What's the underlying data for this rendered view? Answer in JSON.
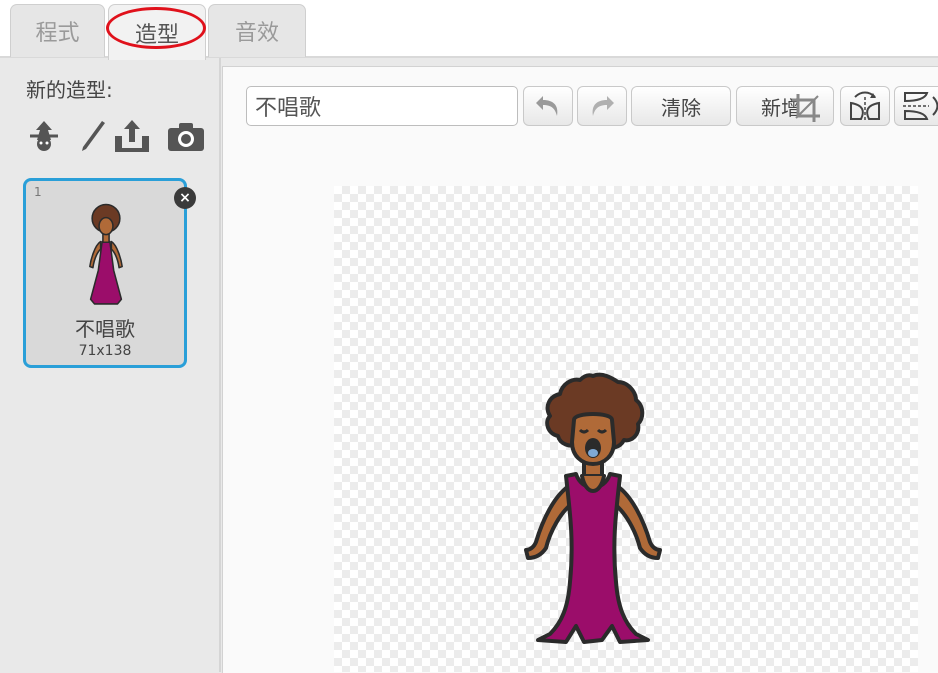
{
  "tabs": [
    {
      "label": "程式",
      "active": false
    },
    {
      "label": "造型",
      "active": true
    },
    {
      "label": "音效",
      "active": false
    }
  ],
  "left_panel": {
    "new_costume_label": "新的造型:",
    "tools": [
      {
        "icon": "paint-icon"
      },
      {
        "icon": "brush-icon"
      },
      {
        "icon": "upload-icon"
      },
      {
        "icon": "camera-icon"
      }
    ],
    "costumes": [
      {
        "number": "1",
        "name": "不唱歌",
        "size": "71x138",
        "selected": true
      }
    ]
  },
  "editor": {
    "costume_name": "不唱歌",
    "clear_label": "清除",
    "add_label": "新增",
    "undo_icon": "undo-icon",
    "redo_icon": "redo-icon",
    "crop_icon": "crop-icon",
    "flip_h_icon": "flip-horizontal-icon",
    "flip_v_icon": "flip-vertical-icon"
  },
  "colors": {
    "selection_border": "#2a9fd8",
    "highlight_circle": "#e0111b",
    "dress": "#9b0d6a",
    "hair": "#6b3a24",
    "skin": "#b06a38"
  }
}
